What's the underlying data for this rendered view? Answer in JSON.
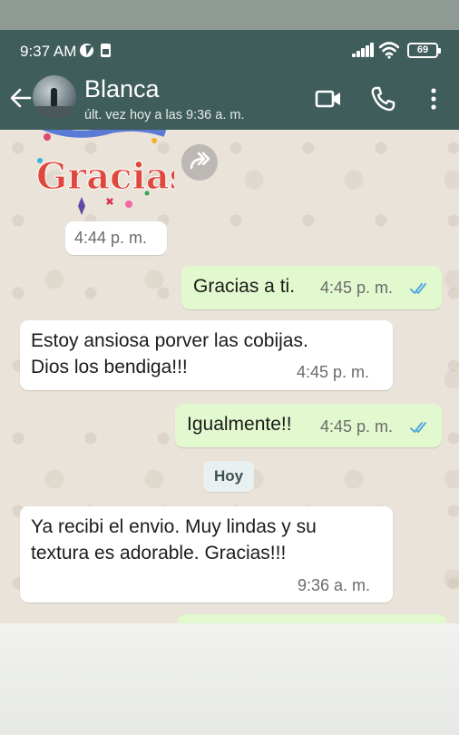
{
  "status_bar": {
    "time": "9:37 AM",
    "battery": "69"
  },
  "header": {
    "contact_name": "Blanca",
    "last_seen": "últ. vez hoy a las 9:36 a. m."
  },
  "sticker": {
    "text": "Gracias",
    "time": "4:44 p. m."
  },
  "messages": [
    {
      "direction": "out",
      "lines": [
        "Gracias a ti."
      ],
      "time": "4:45 p. m.",
      "status": "read"
    },
    {
      "direction": "in",
      "lines": [
        "Estoy ansiosa porver las cobijas.",
        "Dios los bendiga!!!"
      ],
      "time": "4:45 p. m."
    },
    {
      "direction": "out",
      "lines": [
        "Igualmente!!"
      ],
      "time": "4:45 p. m.",
      "status": "read"
    },
    {
      "direction": "in",
      "lines": [
        "Ya recibi el envio. Muy lindas y su",
        "textura es adorable. Gracias!!!"
      ],
      "time": "9:36 a. m."
    }
  ],
  "day_separator": "Hoy",
  "colors": {
    "header": "#3f5d5a",
    "outgoing": "#e2f9cf",
    "incoming": "#ffffff",
    "read_ticks": "#4fa6df"
  },
  "icons": [
    "back-arrow-icon",
    "video-call-icon",
    "phone-call-icon",
    "more-options-icon",
    "forward-icon"
  ]
}
